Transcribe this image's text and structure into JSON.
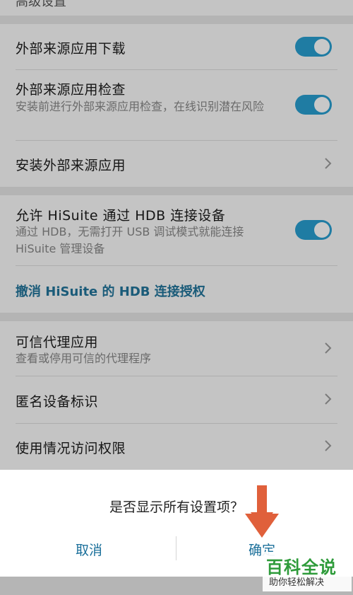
{
  "top": {
    "partial_label": "高级设置"
  },
  "settings": {
    "external_download": {
      "title": "外部来源应用下载",
      "toggle_on": true
    },
    "external_check": {
      "title": "外部来源应用检查",
      "subtitle": "安装前进行外部来源应用检查，在线识别潜在风险",
      "toggle_on": true
    },
    "install_external": {
      "title": "安装外部来源应用"
    },
    "hisuite": {
      "title": "允许 HiSuite 通过 HDB 连接设备",
      "subtitle": "通过 HDB，无需打开 USB 调试模式就能连接 HiSuite 管理设备",
      "toggle_on": true
    },
    "revoke_link": "撤消 HiSuite 的 HDB 连接授权",
    "trust_agents": {
      "title": "可信代理应用",
      "subtitle": "查看或停用可信的代理程序"
    },
    "anon_id": {
      "title": "匿名设备标识"
    },
    "usage_access": {
      "title": "使用情况访问权限"
    }
  },
  "dialog": {
    "title": "是否显示所有设置项？",
    "cancel": "取消",
    "confirm": "确定"
  },
  "watermark": {
    "title": "百科全说",
    "subtitle": "助你轻松解决"
  },
  "colors": {
    "accent": "#1f7ca3",
    "link": "#1a5b79",
    "arrow": "#e0603b",
    "watermark": "#2e9b3a"
  },
  "icons": {
    "chevron": "chevron-right-icon",
    "arrow": "arrow-down-icon"
  }
}
